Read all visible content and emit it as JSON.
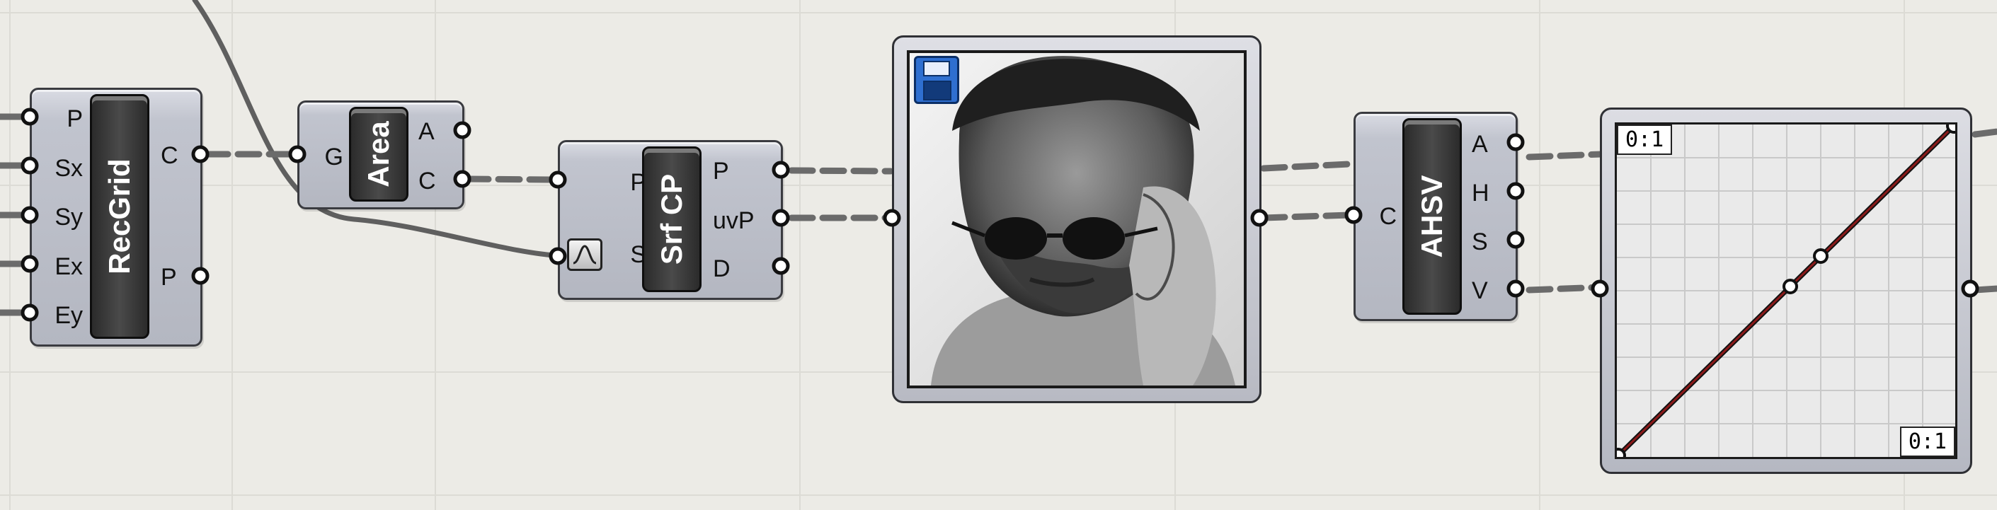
{
  "components": {
    "recgrid": {
      "name": "RecGrid",
      "inputs": [
        "P",
        "Sx",
        "Sy",
        "Ex",
        "Ey"
      ],
      "outputs": [
        "C",
        "P"
      ]
    },
    "area": {
      "name": "Area",
      "inputs": [
        "G"
      ],
      "outputs": [
        "A",
        "C"
      ]
    },
    "srfcp": {
      "name": "Srf CP",
      "inputs": [
        "P",
        "S"
      ],
      "outputs": [
        "P",
        "uvP",
        "D"
      ]
    },
    "ahsv": {
      "name": "AHSV",
      "inputs": [
        "C"
      ],
      "outputs": [
        "A",
        "H",
        "S",
        "V"
      ]
    }
  },
  "graph_mapper": {
    "domain_x_label": "0:1",
    "domain_y_label": "0:1"
  },
  "image_sampler": {
    "icon": "floppy-disk-icon"
  },
  "colors": {
    "canvas": "#ecebe6",
    "component": "#b4b7c1",
    "wire": "#6b6b6b",
    "curve": "#8b1a1a"
  }
}
